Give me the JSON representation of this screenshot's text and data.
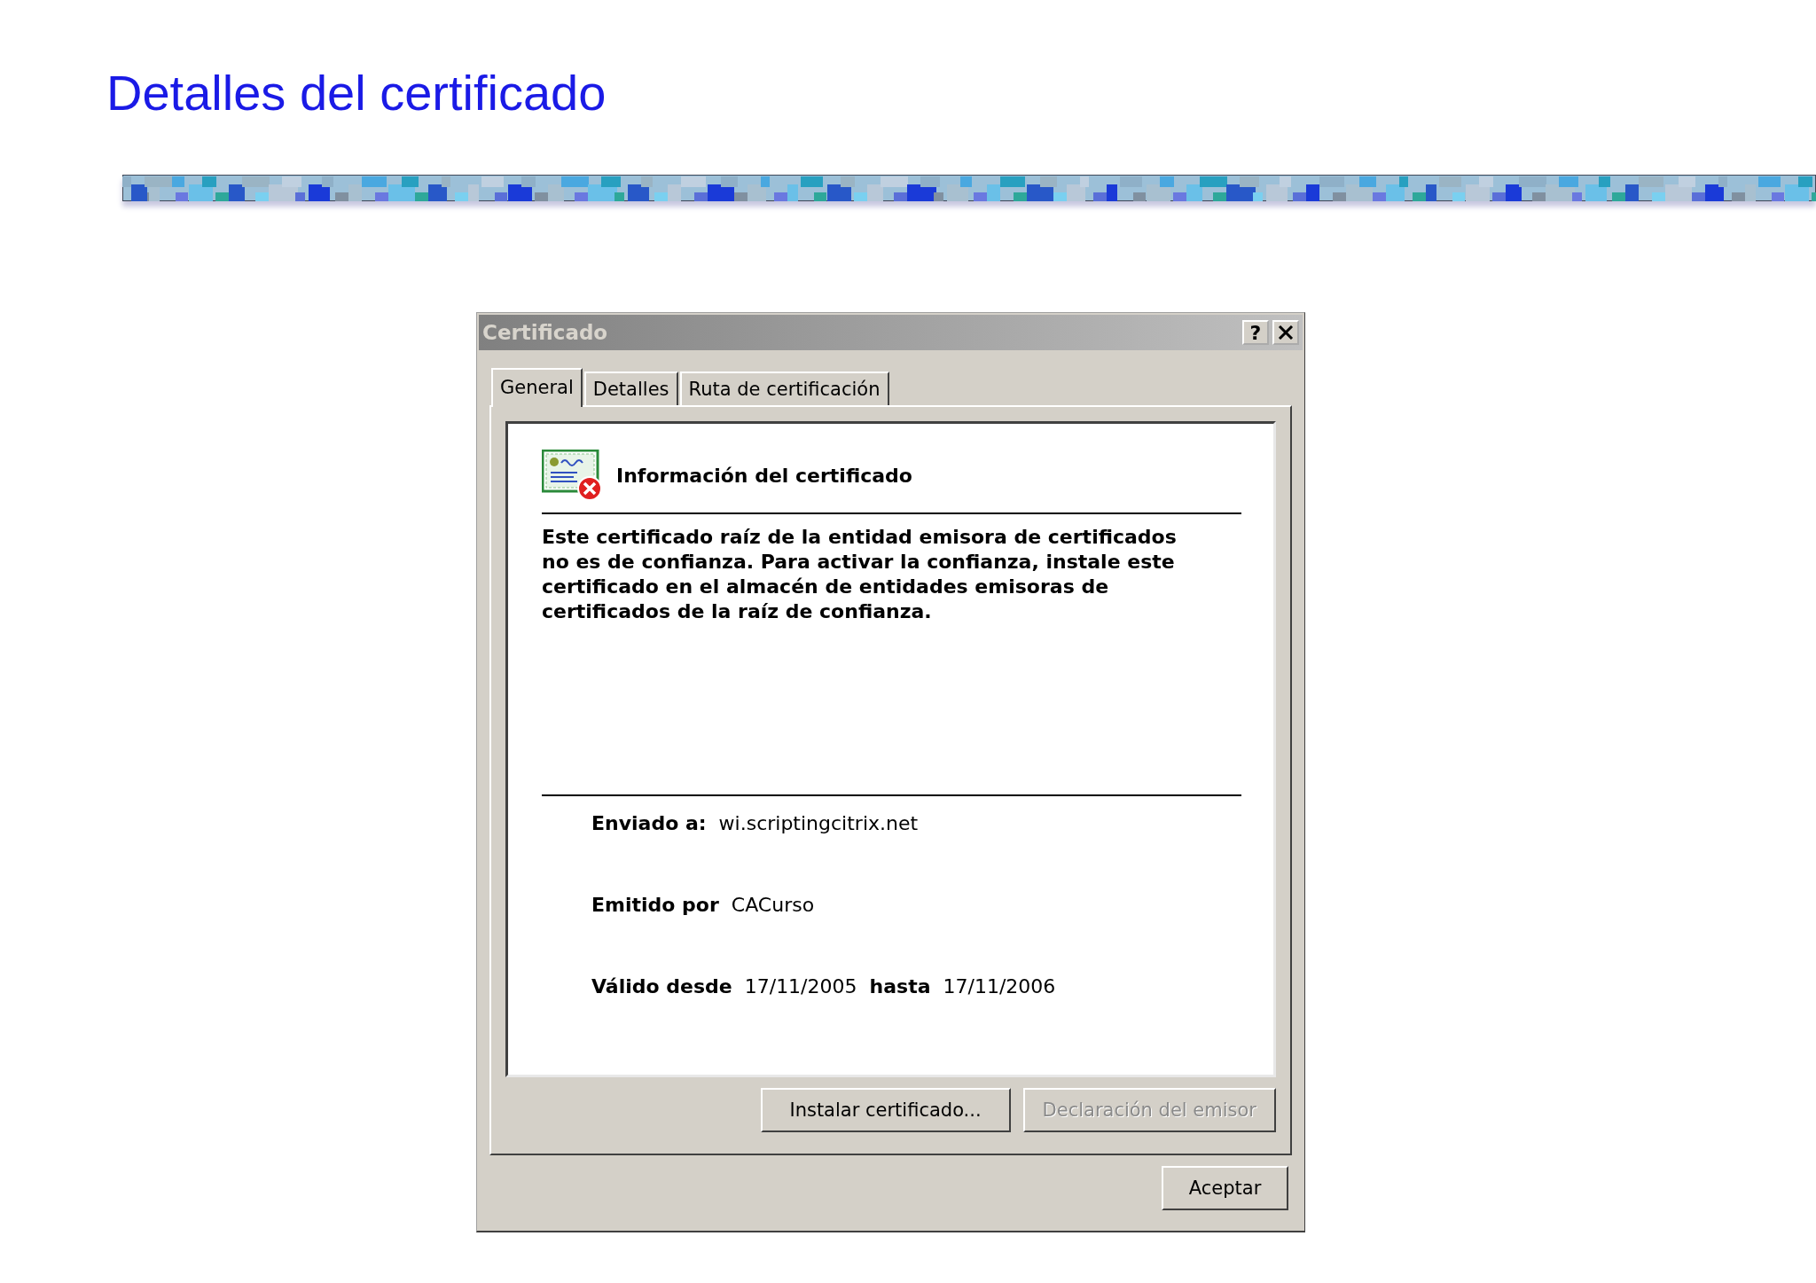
{
  "slide_title": "Detalles del certificado",
  "dialog": {
    "title": "Certificado",
    "help_button": "?",
    "tabs": [
      {
        "label": "General",
        "selected": true
      },
      {
        "label": "Detalles",
        "selected": false
      },
      {
        "label": "Ruta de certificación",
        "selected": false
      }
    ],
    "info_heading": "Información del certificado",
    "message": "Este certificado raíz de la entidad emisora de certificados no es de confianza. Para activar la confianza, instale este certificado en el almacén de entidades emisoras de certificados de la raíz de confianza.",
    "fields": [
      {
        "label": "Enviado a:",
        "value": "wi.scriptingcitrix.net"
      },
      {
        "label": "Emitido por",
        "value": "CACurso"
      }
    ],
    "validity": {
      "from_label": "Válido desde",
      "from": "17/11/2005",
      "to_label": "hasta",
      "to": "17/11/2006"
    },
    "panel_buttons": [
      {
        "label": "Instalar certificado...",
        "disabled": false
      },
      {
        "label": "Declaración del emisor",
        "disabled": true
      }
    ],
    "ok_button": "Aceptar"
  }
}
